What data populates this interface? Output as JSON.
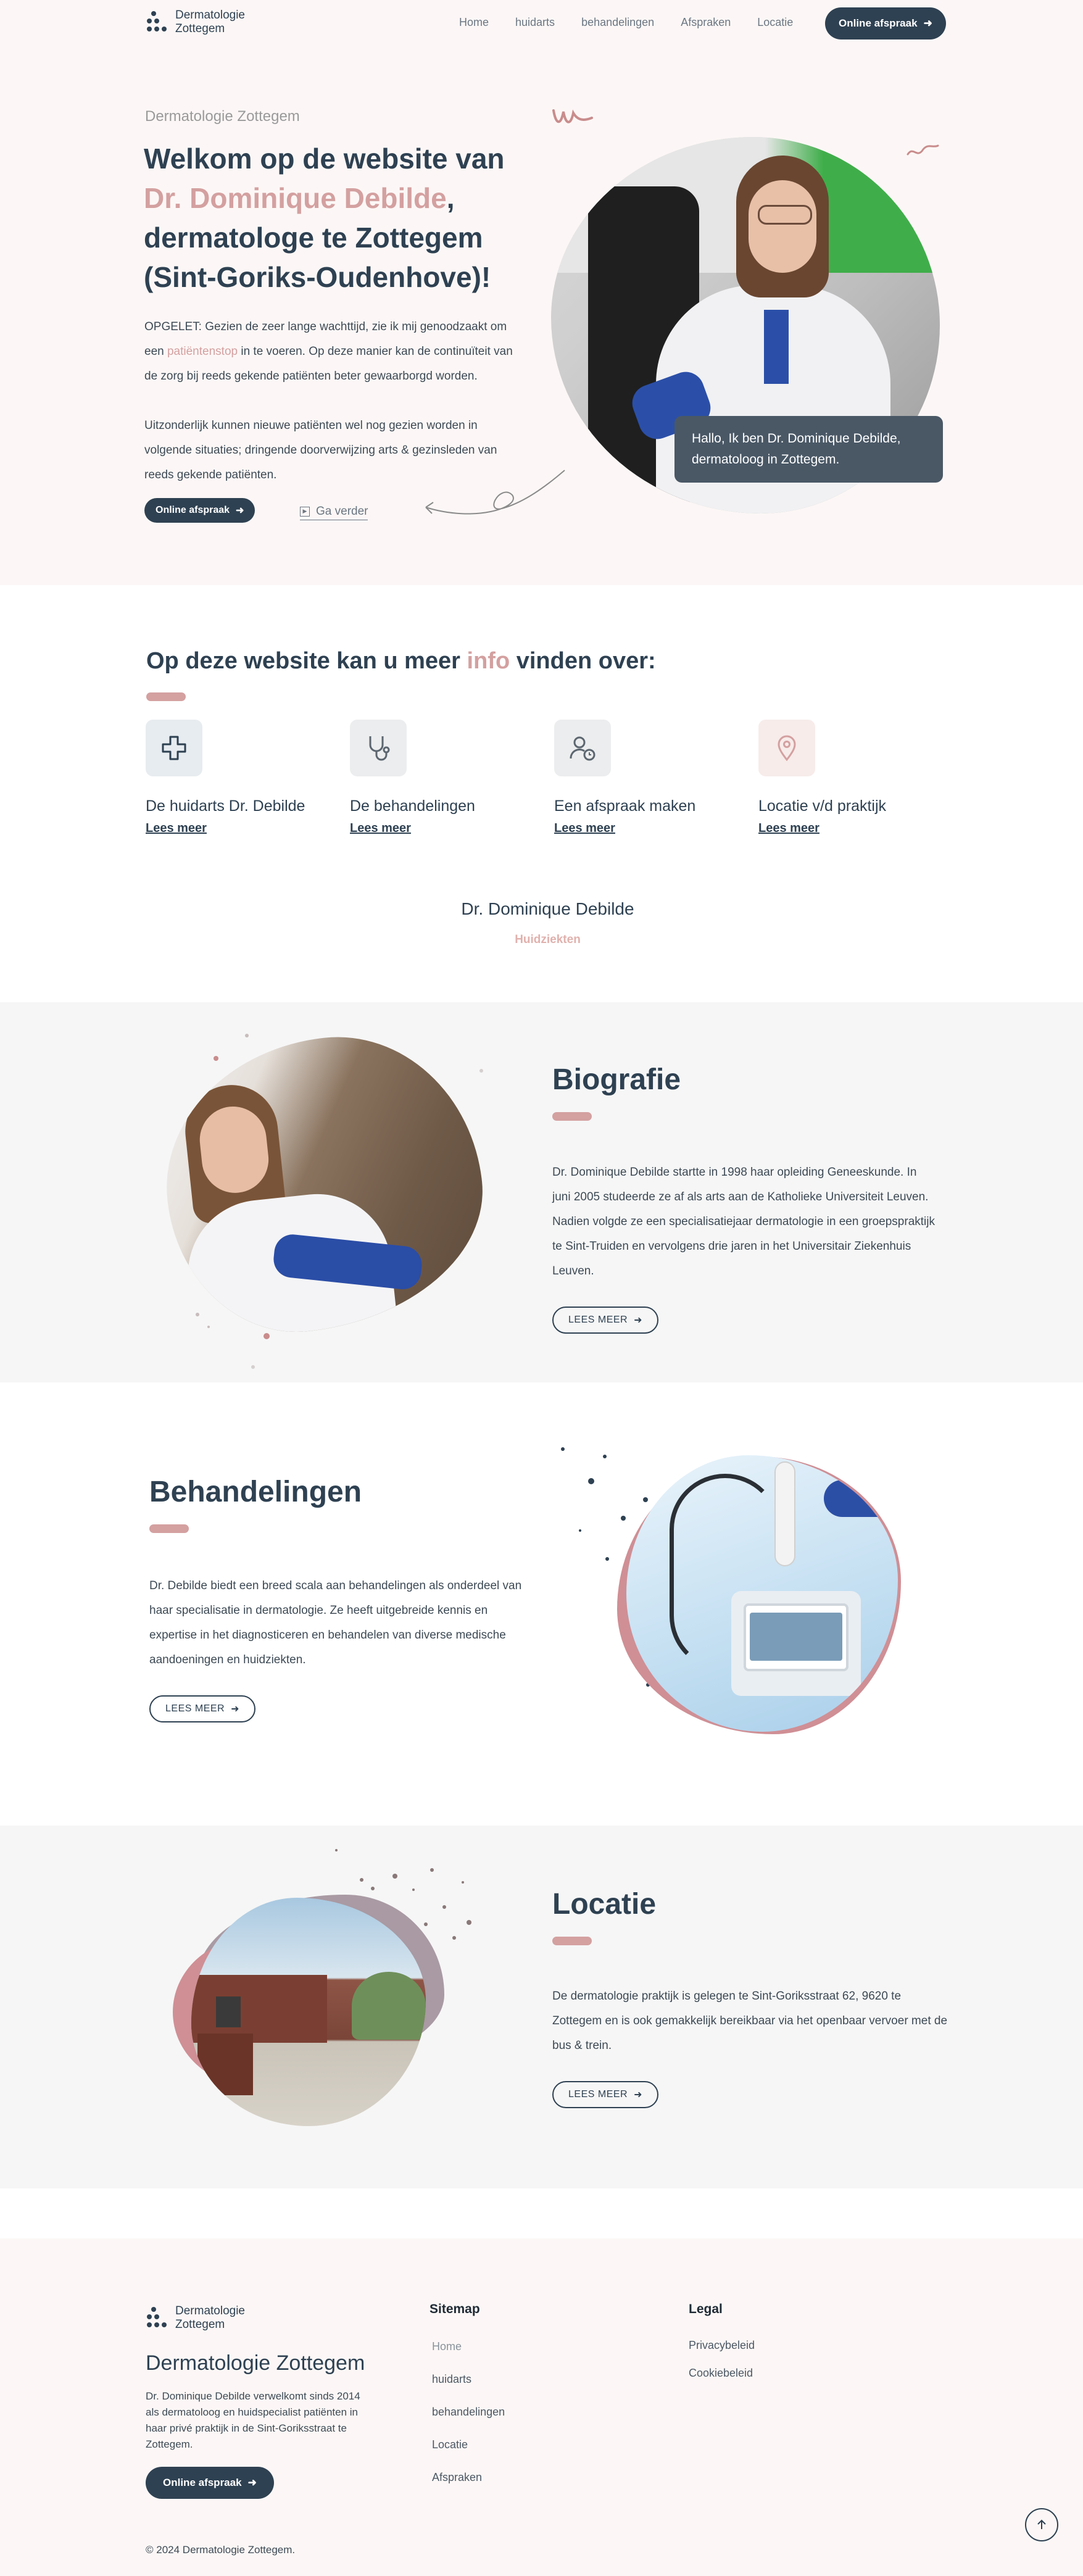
{
  "header": {
    "logo_line1": "Dermatologie",
    "logo_line2": "Zottegem",
    "nav": [
      "Home",
      "huidarts",
      "behandelingen",
      "Afspraken",
      "Locatie"
    ],
    "cta": "Online afspraak"
  },
  "hero": {
    "eyebrow": "Dermatologie Zottegem",
    "title_line1": "Welkom op de website van",
    "title_name": "Dr. Dominique Debilde",
    "title_comma": ",",
    "title_line3": "dermatologe te Zottegem",
    "title_line4": "(Sint-Goriks-Oudenhove)!",
    "para1_a": "OPGELET: Gezien de zeer lange wachttijd, zie ik mij genoodzaakt om een ",
    "para1_link": "patiëntenstop",
    "para1_b": " in te voeren. Op deze manier kan de continuïteit van de zorg bij reeds gekende patiënten beter gewaarborgd worden.",
    "para2": "Uitzonderlijk kunnen nieuwe patiënten wel nog gezien worden in volgende situaties; dringende doorverwijzing arts & gezinsleden van reeds gekende patiënten.",
    "cta": "Online afspraak",
    "secondary": "Ga verder",
    "bubble": "Hallo, Ik ben Dr. Dominique Debilde, dermatoloog in Zottegem."
  },
  "info": {
    "title_a": "Op deze website kan u meer ",
    "title_highlight": "info",
    "title_b": " vinden over:",
    "cards": [
      {
        "title": "De huidarts Dr. Debilde",
        "link": "Lees meer",
        "icon": "medical-cross-icon"
      },
      {
        "title": "De behandelingen",
        "link": "Lees meer",
        "icon": "stethoscope-icon"
      },
      {
        "title": "Een afspraak maken",
        "link": "Lees meer",
        "icon": "user-clock-icon"
      },
      {
        "title": "Locatie v/d praktijk",
        "link": "Lees meer",
        "icon": "location-pin-icon"
      }
    ],
    "doctor_name": "Dr. Dominique Debilde",
    "doctor_sub": "Huidziekten"
  },
  "bio": {
    "title": "Biografie",
    "text": "Dr. Dominique Debilde startte in 1998 haar opleiding Geneeskunde. In juni 2005 studeerde ze af als arts aan de Katholieke Universiteit Leuven. Nadien volgde ze een specialisatiejaar dermatologie in een groepspraktijk te Sint-Truiden en vervolgens drie jaren in het Universitair Ziekenhuis Leuven.",
    "button": "LEES MEER"
  },
  "treatments": {
    "title": "Behandelingen",
    "text": "Dr. Debilde biedt een breed scala aan behandelingen als onderdeel van haar specialisatie in dermatologie. Ze heeft uitgebreide kennis en expertise in het diagnosticeren en behandelen van diverse medische aandoeningen en huidziekten.",
    "button": "LEES MEER"
  },
  "location": {
    "title": "Locatie",
    "text": "De dermatologie praktijk is gelegen te Sint-Goriksstraat 62, 9620 te Zottegem en is ook gemakkelijk bereikbaar via het openbaar vervoer met de bus & trein.",
    "button": "LEES MEER"
  },
  "footer": {
    "logo_line1": "Dermatologie",
    "logo_line2": "Zottegem",
    "brand": "Dermatologie Zottegem",
    "about": "Dr. Dominique Debilde verwelkomt sinds 2014 als dermatoloog en huidspecialist patiënten in haar privé praktijk in de Sint-Goriksstraat te Zottegem.",
    "cta": "Online afspraak",
    "sitemap_title": "Sitemap",
    "sitemap": [
      "Home",
      "huidarts",
      "behandelingen",
      "Locatie",
      "Afspraken"
    ],
    "legal_title": "Legal",
    "legal": [
      "Privacybeleid",
      "Cookiebeleid"
    ],
    "copyright": "© 2024 Dermatologie Zottegem."
  },
  "colors": {
    "navy": "#2e4152",
    "pink": "#d4a0a0",
    "hero_bg": "#fcf7f6",
    "grey_bg": "#f6f6f6"
  }
}
